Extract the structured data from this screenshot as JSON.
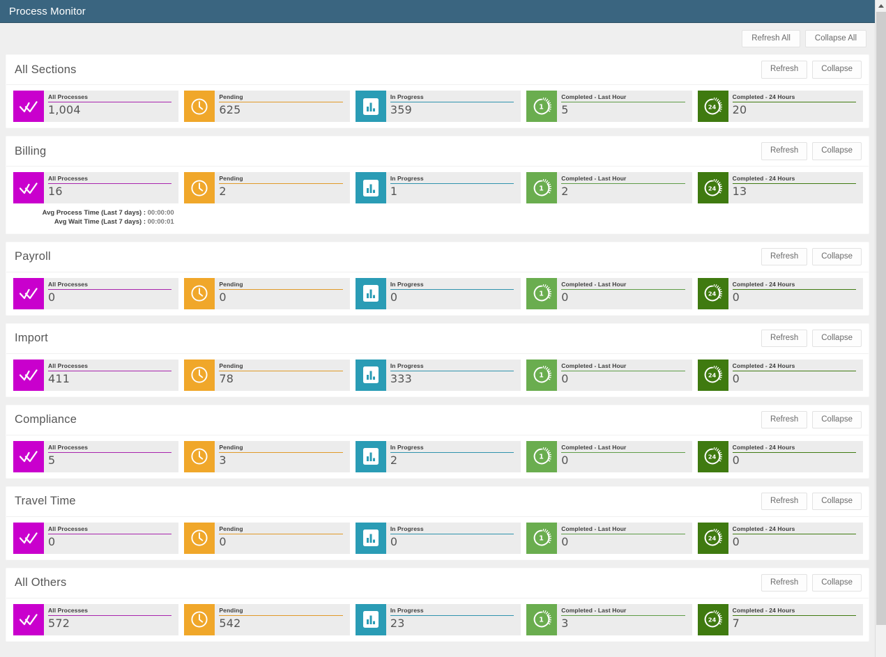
{
  "app": {
    "title": "Process Monitor",
    "header_bg": "#3a6580"
  },
  "global_toolbar": {
    "refresh_all_label": "Refresh All",
    "collapse_all_label": "Collapse All"
  },
  "panel_actions": {
    "refresh_label": "Refresh",
    "collapse_label": "Collapse"
  },
  "metrics": [
    {
      "key": "all",
      "label": "All Processes",
      "icon": "double-check-icon",
      "color": "#c900cd"
    },
    {
      "key": "pend",
      "label": "Pending",
      "icon": "clock-icon",
      "color": "#f0a72a"
    },
    {
      "key": "prog",
      "label": "In Progress",
      "icon": "bar-chart-icon",
      "color": "#2a9cb5"
    },
    {
      "key": "hour",
      "label": "Completed - Last Hour",
      "icon": "clock-1-hour-icon",
      "color": "#6aad4f"
    },
    {
      "key": "day",
      "label": "Completed - 24 Hours",
      "icon": "clock-24-hour-icon",
      "color": "#3f7a10"
    }
  ],
  "sections": [
    {
      "title": "All Sections",
      "values": [
        "1,004",
        "625",
        "359",
        "5",
        "20"
      ],
      "extra": []
    },
    {
      "title": "Billing",
      "values": [
        "16",
        "2",
        "1",
        "2",
        "13"
      ],
      "extra": [
        {
          "label": "Avg Process Time (Last 7 days) :",
          "value": "00:00:00"
        },
        {
          "label": "Avg Wait Time (Last 7 days) :",
          "value": "00:00:01"
        }
      ]
    },
    {
      "title": "Payroll",
      "values": [
        "0",
        "0",
        "0",
        "0",
        "0"
      ],
      "extra": []
    },
    {
      "title": "Import",
      "values": [
        "411",
        "78",
        "333",
        "0",
        "0"
      ],
      "extra": []
    },
    {
      "title": "Compliance",
      "values": [
        "5",
        "3",
        "2",
        "0",
        "0"
      ],
      "extra": []
    },
    {
      "title": "Travel Time",
      "values": [
        "0",
        "0",
        "0",
        "0",
        "0"
      ],
      "extra": []
    },
    {
      "title": "All Others",
      "values": [
        "572",
        "542",
        "23",
        "3",
        "7"
      ],
      "extra": []
    }
  ]
}
